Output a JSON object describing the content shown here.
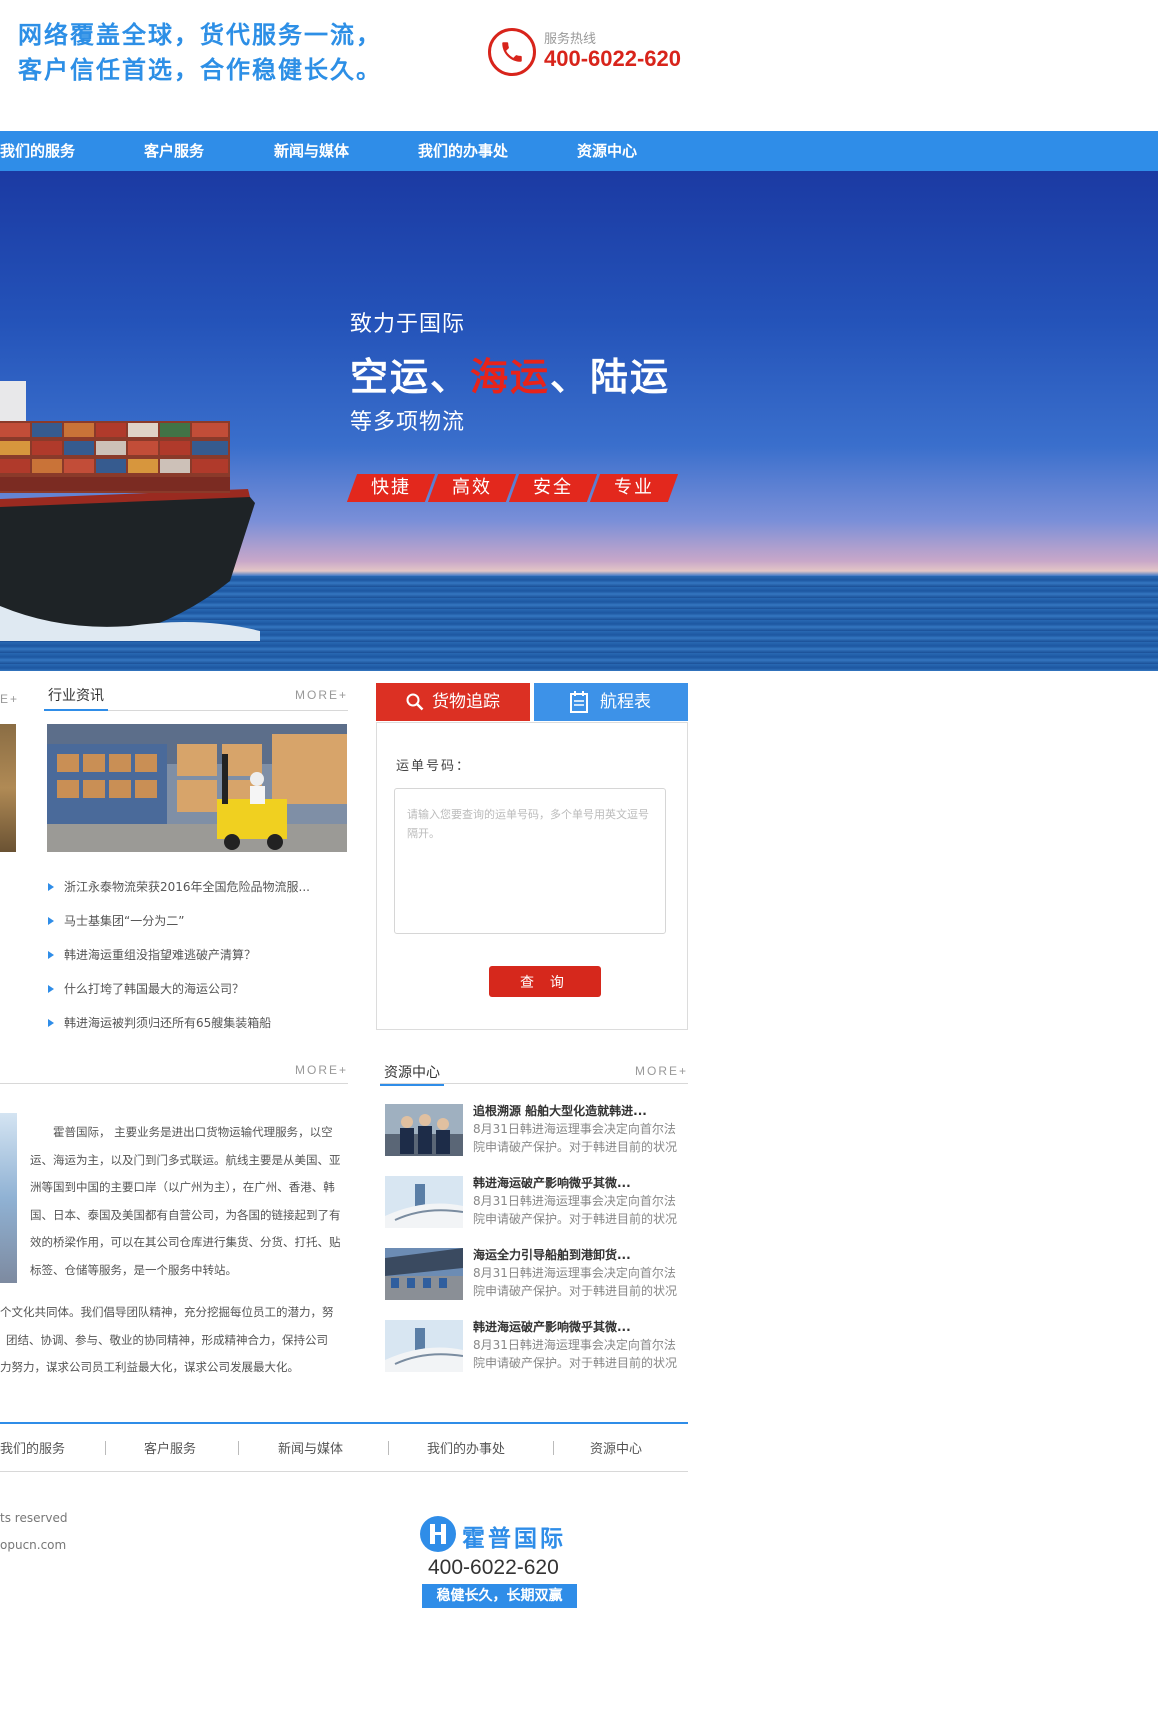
{
  "header": {
    "slogan_line1": "网络覆盖全球，货代服务一流，",
    "slogan_line2": "客户信任首选，合作稳健长久。",
    "hotline_label": "服务热线",
    "hotline_number": "400-6022-620"
  },
  "nav": {
    "items": [
      "我们的服务",
      "客户服务",
      "新闻与媒体",
      "我们的办事处",
      "资源中心"
    ]
  },
  "banner": {
    "line1": "致力于国际",
    "line2_a": "空运、",
    "line2_b": "海运",
    "line2_c": "、陆运",
    "line3": "等多项物流",
    "tags": [
      "快捷",
      "高效",
      "安全",
      "专业"
    ]
  },
  "industry_news": {
    "title": "行业资讯",
    "more": "MORE+",
    "left_more": "E+",
    "items": [
      "浙江永泰物流荣获2016年全国危险品物流服...",
      "马士基集团“一分为二”",
      "韩进海运重组没指望难逃破产清算？",
      "什么打垮了韩国最大的海运公司？",
      "韩进海运被判须归还所有65艘集装箱船"
    ]
  },
  "tracking": {
    "tab_track": "货物追踪",
    "tab_schedule": "航程表",
    "label": "运单号码：",
    "placeholder": "请输入您要查询的运单号码，多个单号用英文逗号隔开。",
    "button": "查 询"
  },
  "about": {
    "more": "MORE+",
    "para1": "霍普国际， 主要业务是进出口货物运输代理服务，以空运、海运为主，以及门到门多式联运。航线主要是从美国、亚洲等国到中国的主要口岸（以广州为主），在广州、香港、韩国、日本、泰国及美国都有自营公司，为各国的链接起到了有效的桥梁作用，可以在其公司仓库进行集货、分货、打托、贴标签、仓储等服务，是一个服务中转站。",
    "para2_line1": "个文化共同体。我们倡导团队精神，充分挖掘每位员工的潜力，努",
    "para2_line2": "团结、协调、参与、敬业的协同精神，形成精神合力，保持公司",
    "para2_line3": "力努力，谋求公司员工利益最大化，谋求公司发展最大化。"
  },
  "resources": {
    "title": "资源中心",
    "more": "MORE+",
    "items": [
      {
        "title": "追根溯源 船舶大型化造就韩进...",
        "desc": "8月31日韩进海运理事会决定向首尔法院申请破产保护。对于韩进目前的状况"
      },
      {
        "title": "韩进海运破产影响微乎其微...",
        "desc": "8月31日韩进海运理事会决定向首尔法院申请破产保护。对于韩进目前的状况"
      },
      {
        "title": "海运全力引导船舶到港卸货...",
        "desc": "8月31日韩进海运理事会决定向首尔法院申请破产保护。对于韩进目前的状况"
      },
      {
        "title": "韩进海运破产影响微乎其微...",
        "desc": "8月31日韩进海运理事会决定向首尔法院申请破产保护。对于韩进目前的状况"
      }
    ]
  },
  "footer": {
    "nav": [
      "我们的服务",
      "客户服务",
      "新闻与媒体",
      "我们的办事处",
      "资源中心"
    ],
    "copyright": "ts reserved",
    "site": "opucn.com",
    "logo_text": "霍普国际",
    "phone": "400-6022-620",
    "slogan": "稳健长久，长期双赢"
  },
  "colors": {
    "primary_blue": "#2f8de8",
    "accent_red": "#d8241b"
  }
}
